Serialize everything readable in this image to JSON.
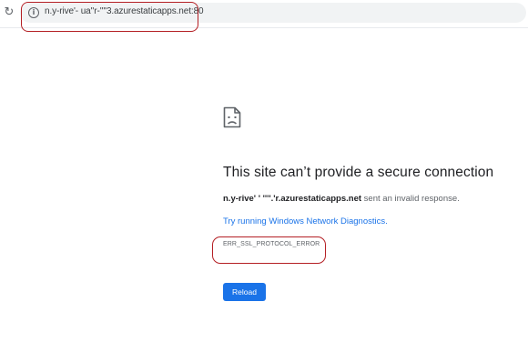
{
  "browser": {
    "reload_icon": "reload-icon",
    "info_icon": "info-icon",
    "address_url": "n.y-rive'- ua''r-''''3.azurestaticapps.net:80"
  },
  "error": {
    "icon": "sad-page-icon",
    "title": "This site can’t provide a secure connection",
    "host": "n.y-rive' ' ''''.'r.azurestaticapps.net",
    "message_suffix": " sent an invalid response.",
    "diagnostics_link": "Try running Windows Network Diagnostics.",
    "code": "ERR_SSL_PROTOCOL_ERROR",
    "reload_label": "Reload"
  },
  "colors": {
    "accent": "#1a73e8",
    "annotation": "#b41f24"
  }
}
